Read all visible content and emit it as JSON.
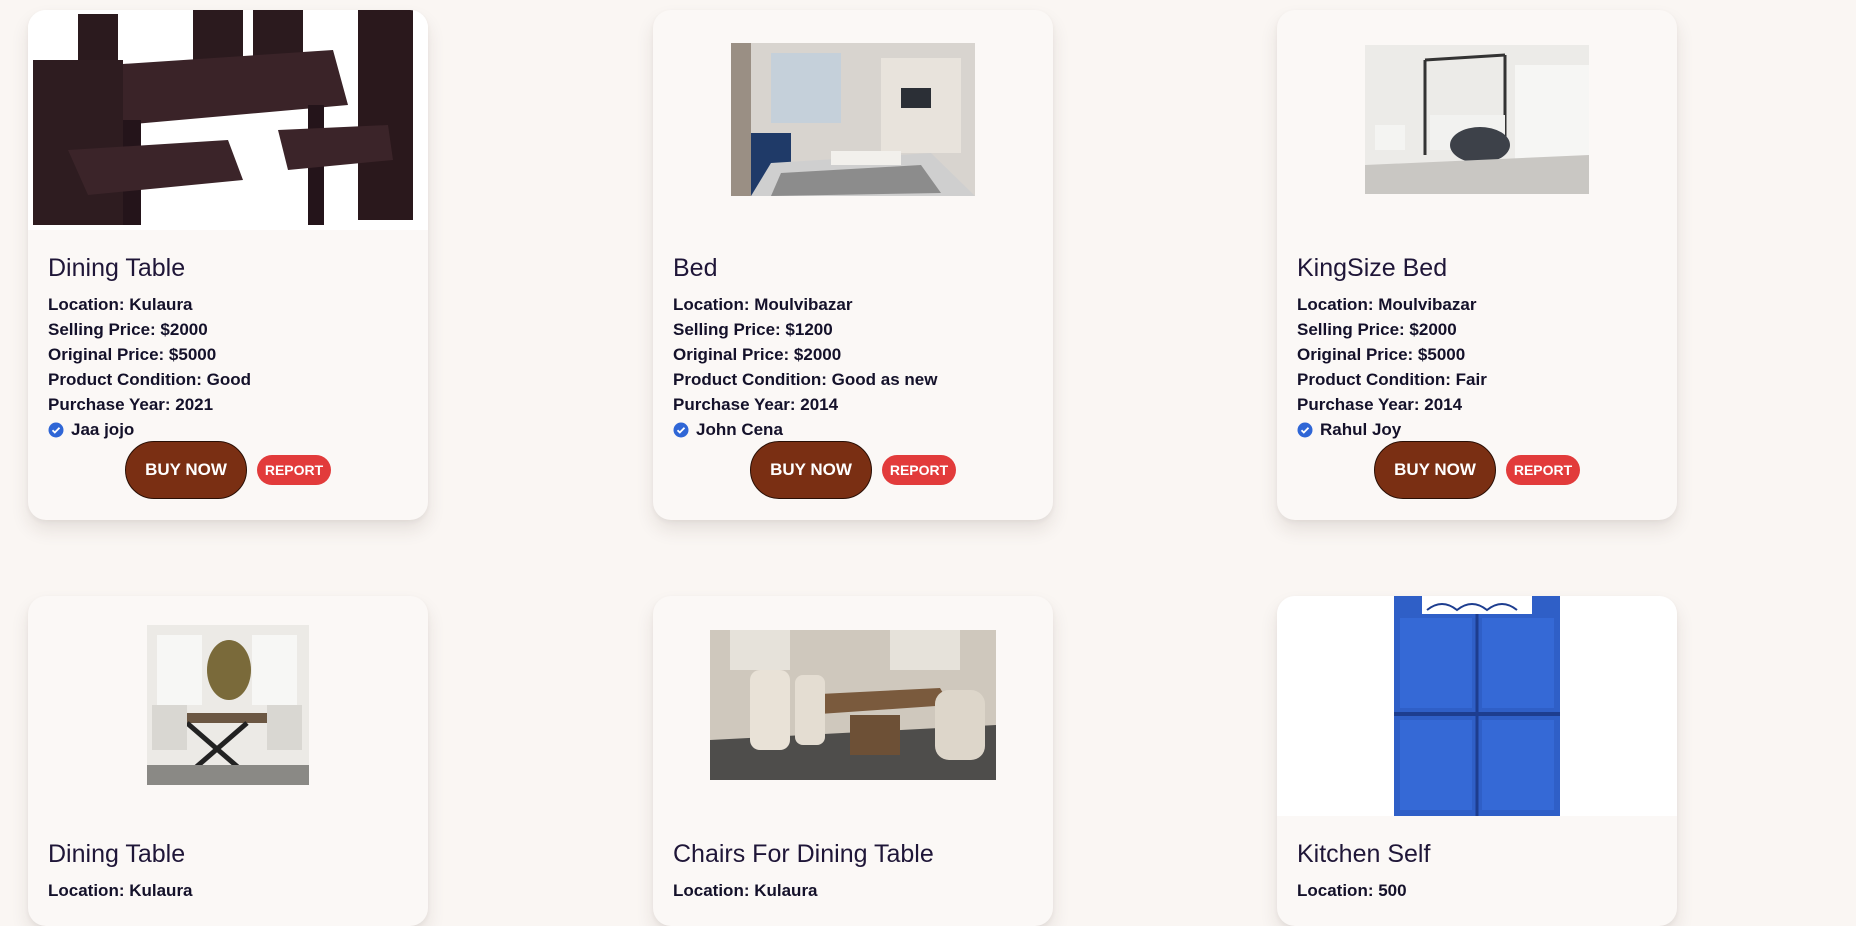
{
  "buttons": {
    "buy_label": "BUY NOW",
    "report_label": "REPORT"
  },
  "colors": {
    "buy": "#7a2f13",
    "report": "#e23b3b",
    "verified": "#2f66d6",
    "background": "#faf6f3"
  },
  "products": [
    {
      "name": "Dining Table",
      "location": "Location: Kulaura",
      "selling_price": "Selling Price: $2000",
      "original_price": "Original Price: $5000",
      "condition": "Product Condition: Good",
      "purchase_year": "Purchase Year: 2021",
      "seller": "Jaa jojo",
      "verified_icon": "verified-badge-icon"
    },
    {
      "name": "Bed",
      "location": "Location: Moulvibazar",
      "selling_price": "Selling Price: $1200",
      "original_price": "Original Price: $2000",
      "condition": "Product Condition: Good as new",
      "purchase_year": "Purchase Year: 2014",
      "seller": "John Cena",
      "verified_icon": "verified-badge-icon"
    },
    {
      "name": "KingSize Bed",
      "location": "Location: Moulvibazar",
      "selling_price": "Selling Price: $2000",
      "original_price": "Original Price: $5000",
      "condition": "Product Condition: Fair",
      "purchase_year": "Purchase Year: 2014",
      "seller": "Rahul Joy",
      "verified_icon": "verified-badge-icon"
    },
    {
      "name": "Dining Table",
      "location": "Location: Kulaura"
    },
    {
      "name": "Chairs For Dining Table",
      "location": "Location: Kulaura"
    },
    {
      "name": "Kitchen Self",
      "location": "Location: 500"
    }
  ]
}
